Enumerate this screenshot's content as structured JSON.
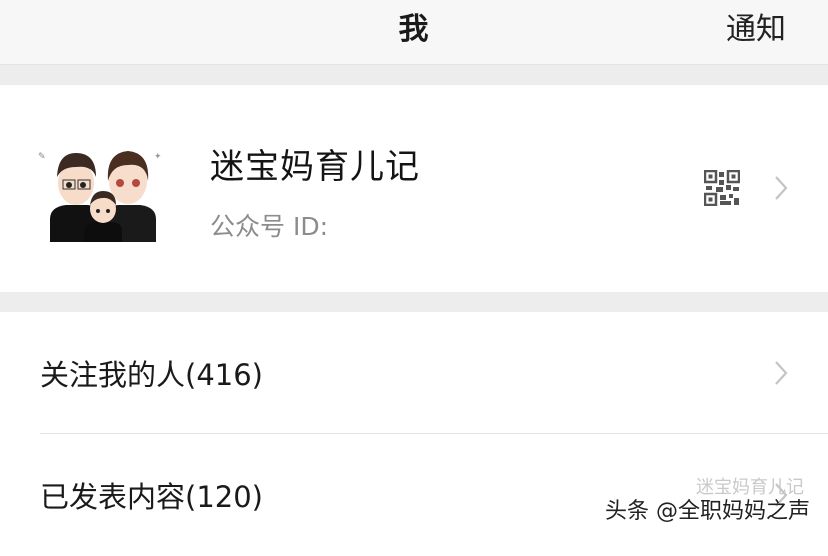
{
  "header": {
    "title": "我",
    "notify_label": "通知"
  },
  "profile": {
    "name": "迷宝妈育儿记",
    "id_label": "公众号 ID:"
  },
  "menu": {
    "items": [
      {
        "label": "关注我的人(416)"
      },
      {
        "label": "已发表内容(120)"
      }
    ]
  },
  "watermark": {
    "text": "头条 @全职妈妈之声",
    "faint_text": "迷宝妈育儿记"
  },
  "colors": {
    "nav_bg": "#f7f7f7",
    "gap_bg": "#ededed",
    "secondary_text": "#8c8c8c",
    "chevron": "#c4c4c4"
  }
}
